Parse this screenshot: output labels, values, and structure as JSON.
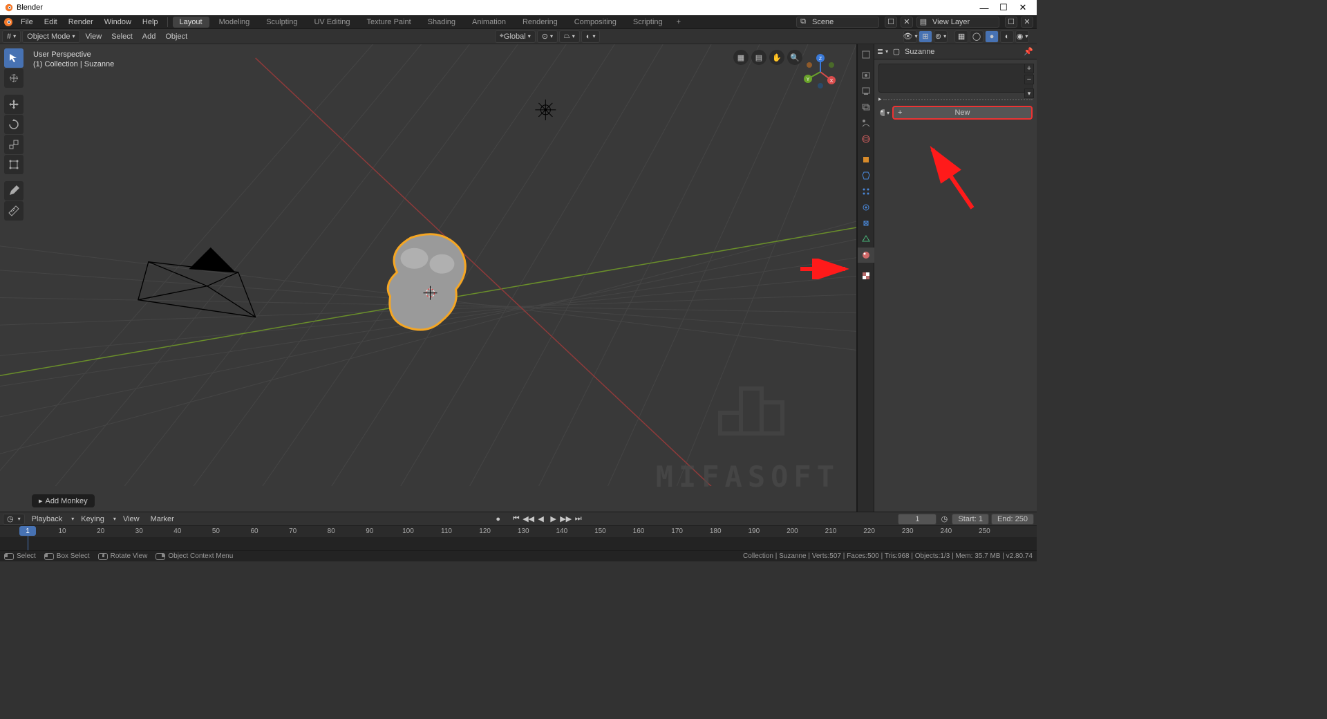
{
  "window": {
    "title": "Blender"
  },
  "menubar": {
    "items": [
      "File",
      "Edit",
      "Render",
      "Window",
      "Help"
    ],
    "workspaces": [
      "Layout",
      "Modeling",
      "Sculpting",
      "UV Editing",
      "Texture Paint",
      "Shading",
      "Animation",
      "Rendering",
      "Compositing",
      "Scripting"
    ],
    "active_workspace": "Layout",
    "scene_label": "Scene",
    "viewlayer_label": "View Layer"
  },
  "viewheader": {
    "mode": "Object Mode",
    "menus": [
      "View",
      "Select",
      "Add",
      "Object"
    ],
    "orientation": "Global"
  },
  "viewport": {
    "perspective": "User Perspective",
    "collection_line": "(1) Collection | Suzanne",
    "lastop": "Add Monkey",
    "watermark": "MIFASOFT"
  },
  "outliner": {
    "object": "Suzanne"
  },
  "properties": {
    "new_label": "New"
  },
  "timeline": {
    "menus": [
      "Playback",
      "Keying",
      "View",
      "Marker"
    ],
    "start_label": "Start:",
    "end_label": "End:",
    "start": 1,
    "end": 250,
    "current": 1,
    "ticks": [
      10,
      20,
      30,
      40,
      50,
      60,
      70,
      80,
      90,
      100,
      110,
      120,
      130,
      140,
      150,
      160,
      170,
      180,
      190,
      200,
      210,
      220,
      230,
      240,
      250
    ]
  },
  "statusbar": {
    "hints": [
      {
        "button": "l",
        "text": "Select"
      },
      {
        "button": "l",
        "text": "Box Select"
      },
      {
        "button": "m",
        "text": "Rotate View"
      },
      {
        "button": "r",
        "text": "Object Context Menu"
      }
    ],
    "right": "Collection | Suzanne | Verts:507 | Faces:500 | Tris:968 | Objects:1/3 | Mem: 35.7 MB | v2.80.74"
  }
}
